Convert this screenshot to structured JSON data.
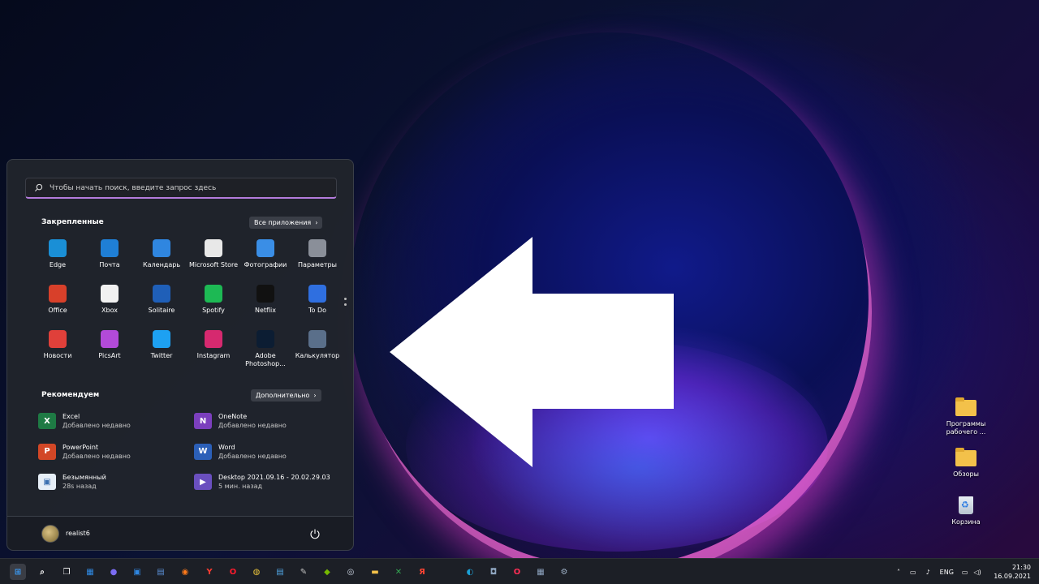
{
  "start_menu": {
    "search_placeholder": "Чтобы начать поиск, введите запрос здесь",
    "pinned_title": "Закрепленные",
    "all_apps_label": "Все приложения",
    "pinned": [
      {
        "label": "Edge",
        "icon": "edge-icon",
        "color": "#1a8fd6"
      },
      {
        "label": "Почта",
        "icon": "mail-icon",
        "color": "#1f7fd6"
      },
      {
        "label": "Календарь",
        "icon": "calendar-icon",
        "color": "#2f86e0"
      },
      {
        "label": "Microsoft Store",
        "icon": "store-icon",
        "color": "#e8e8e8"
      },
      {
        "label": "Фотографии",
        "icon": "photos-icon",
        "color": "#3a8ee6"
      },
      {
        "label": "Параметры",
        "icon": "gear-icon",
        "color": "#8a8f99"
      },
      {
        "label": "Office",
        "icon": "office-icon",
        "color": "#d8402a"
      },
      {
        "label": "Xbox",
        "icon": "xbox-icon",
        "color": "#f1f1f1"
      },
      {
        "label": "Solitaire",
        "icon": "cards-icon",
        "color": "#1f5fb8"
      },
      {
        "label": "Spotify",
        "icon": "spotify-icon",
        "color": "#1db954"
      },
      {
        "label": "Netflix",
        "icon": "netflix-icon",
        "color": "#111111"
      },
      {
        "label": "To Do",
        "icon": "checkmark-icon",
        "color": "#2f6fe0"
      },
      {
        "label": "Новости",
        "icon": "news-icon",
        "color": "#e0403a"
      },
      {
        "label": "PicsArt",
        "icon": "picsart-icon",
        "color": "#b24ad8"
      },
      {
        "label": "Twitter",
        "icon": "twitter-icon",
        "color": "#1da1f2"
      },
      {
        "label": "Instagram",
        "icon": "instagram-icon",
        "color": "#d6296f"
      },
      {
        "label": "Adobe Photoshop...",
        "icon": "photoshop-icon",
        "color": "#0c1d33"
      },
      {
        "label": "Калькулятор",
        "icon": "calculator-icon",
        "color": "#5a6f8a"
      }
    ],
    "recommended_title": "Рекомендуем",
    "more_label": "Дополнительно",
    "recommended": [
      {
        "name": "Excel",
        "sub": "Добавлено недавно",
        "icon": "excel-icon",
        "color": "#1e7a44",
        "glyph": "X"
      },
      {
        "name": "OneNote",
        "sub": "Добавлено недавно",
        "icon": "onenote-icon",
        "color": "#7b3fbd",
        "glyph": "N"
      },
      {
        "name": "PowerPoint",
        "sub": "Добавлено недавно",
        "icon": "powerpoint-icon",
        "color": "#d24726",
        "glyph": "P"
      },
      {
        "name": "Word",
        "sub": "Добавлено недавно",
        "icon": "word-icon",
        "color": "#2b5fb8",
        "glyph": "W"
      },
      {
        "name": "Безымянный",
        "sub": "28s назад",
        "icon": "image-file-icon",
        "color": "#e6eef7",
        "glyph": "▣"
      },
      {
        "name": "Desktop 2021.09.16 - 20.02.29.03",
        "sub": "5 мин. назад",
        "icon": "video-file-icon",
        "color": "#6a4fbf",
        "glyph": "▶"
      }
    ],
    "user_name": "realist6"
  },
  "desktop_icons": [
    {
      "label": "Программы рабочего ...",
      "icon": "folder-icon"
    },
    {
      "label": "Обзоры",
      "icon": "folder-icon"
    },
    {
      "label": "Корзина",
      "icon": "recycle-bin-icon"
    }
  ],
  "taskbar": {
    "items": [
      {
        "name": "start-button",
        "glyph": "⊞",
        "color": "#3aa0ff"
      },
      {
        "name": "search-button",
        "glyph": "⌕",
        "color": "#ffffff"
      },
      {
        "name": "task-view-button",
        "glyph": "❐",
        "color": "#ffffff"
      },
      {
        "name": "widgets-button",
        "glyph": "▦",
        "color": "#2f8be6"
      },
      {
        "name": "chat-button",
        "glyph": "●",
        "color": "#7b6cf2"
      },
      {
        "name": "store-button",
        "glyph": "▣",
        "color": "#2f86e0"
      },
      {
        "name": "app-button",
        "glyph": "▤",
        "color": "#5a8fd6"
      },
      {
        "name": "firefox-button",
        "glyph": "◉",
        "color": "#ff7a1a"
      },
      {
        "name": "yandex-button",
        "glyph": "Y",
        "color": "#ff3b30"
      },
      {
        "name": "opera-button",
        "glyph": "O",
        "color": "#ff1b2d"
      },
      {
        "name": "chrome-button",
        "glyph": "◍",
        "color": "#e8c23a"
      },
      {
        "name": "notepad-button",
        "glyph": "▤",
        "color": "#4fa3e0"
      },
      {
        "name": "app-button-2",
        "glyph": "✎",
        "color": "#c0c0c0"
      },
      {
        "name": "nvidia-button",
        "glyph": "◆",
        "color": "#76b900"
      },
      {
        "name": "steam-button",
        "glyph": "◎",
        "color": "#cfd8e6"
      },
      {
        "name": "explorer-button",
        "glyph": "▬",
        "color": "#f3c14a"
      },
      {
        "name": "xbox-button",
        "glyph": "✕",
        "color": "#34a853"
      },
      {
        "name": "yandex-browser-button",
        "glyph": "Я",
        "color": "#ff4433"
      },
      {
        "name": "edge-button",
        "glyph": "◐",
        "color": "#1aa0d6"
      },
      {
        "name": "camera-button",
        "glyph": "◘",
        "color": "#8fa6c0"
      },
      {
        "name": "opera-gx-button",
        "glyph": "O",
        "color": "#ff2d55"
      },
      {
        "name": "calculator-button",
        "glyph": "▦",
        "color": "#8da3bf"
      },
      {
        "name": "settings-button",
        "glyph": "⚙",
        "color": "#9fb2c8"
      }
    ],
    "lang": "ENG",
    "time": "21:30",
    "date": "16.09.2021"
  }
}
